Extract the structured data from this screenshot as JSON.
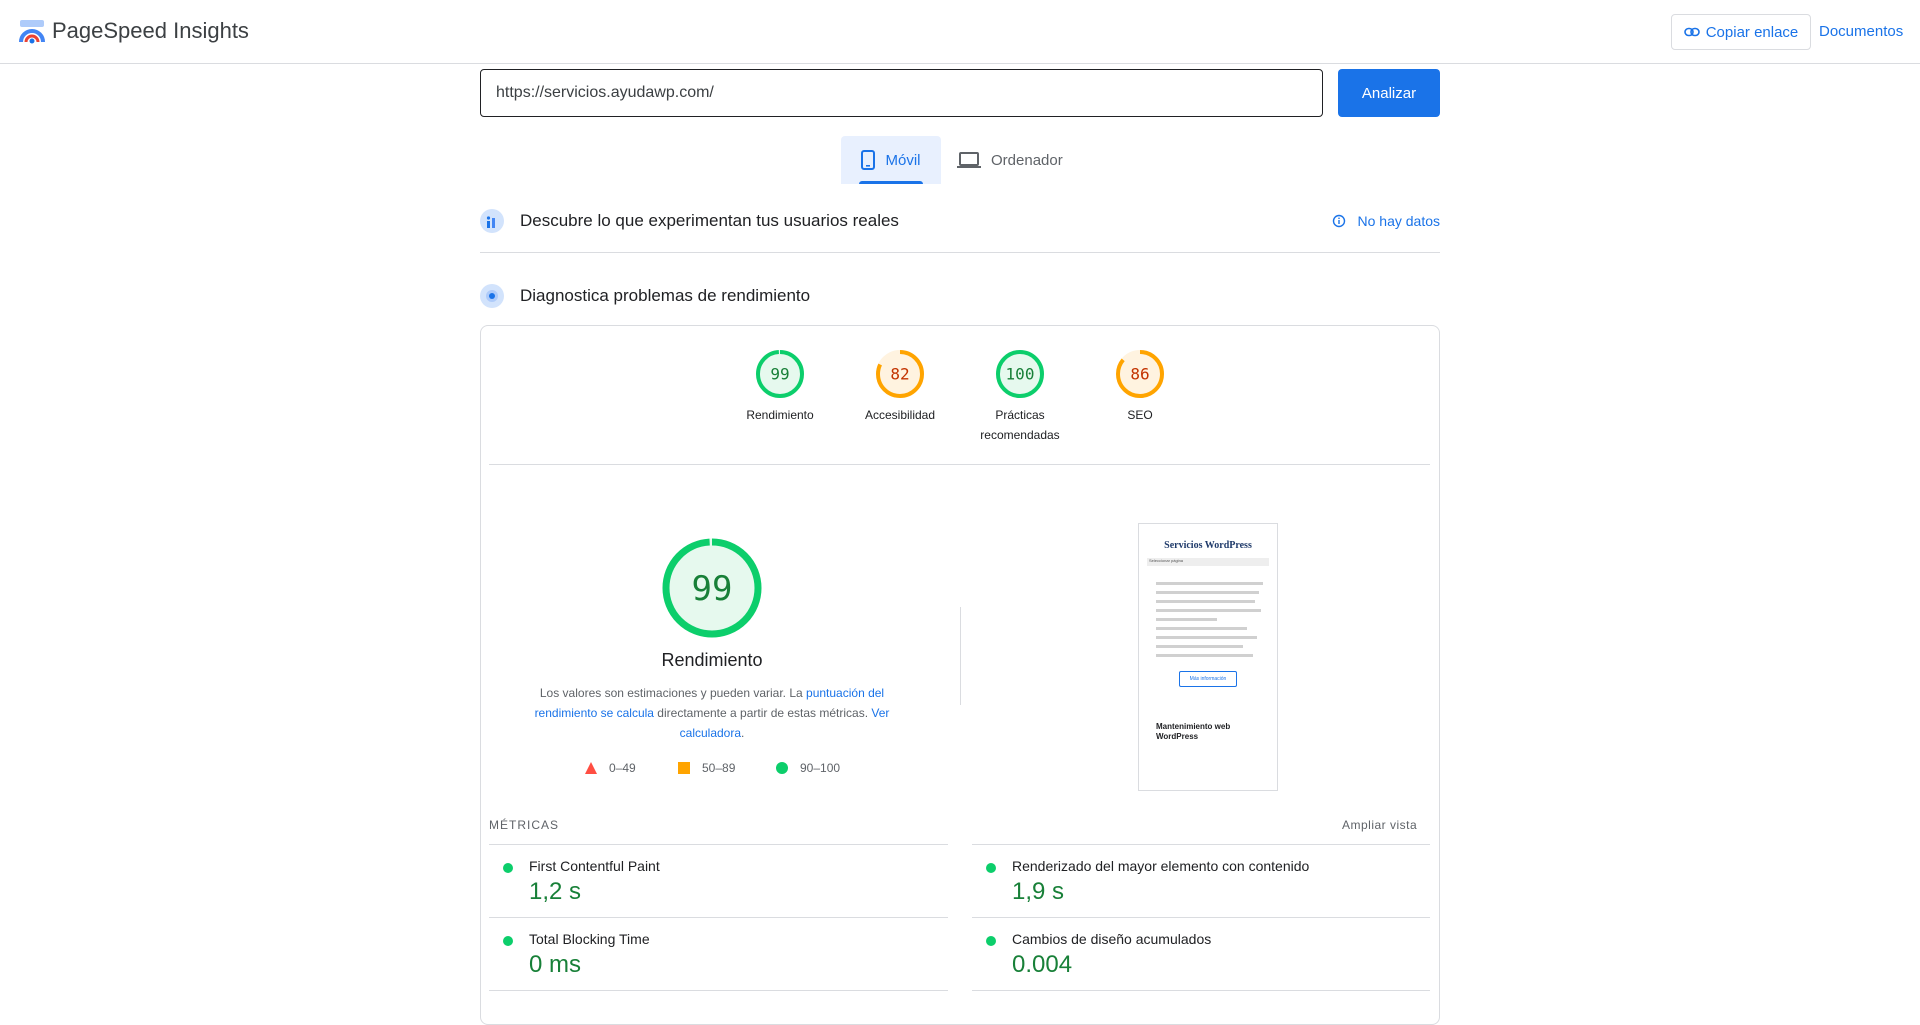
{
  "header": {
    "app_name": "PageSpeed Insights",
    "copy_link_label": "Copiar enlace",
    "docs_label": "Documentos"
  },
  "search": {
    "url_value": "https://servicios.ayudawp.com/",
    "analyze_label": "Analizar"
  },
  "device_tabs": [
    {
      "label": "Móvil",
      "selected": true
    },
    {
      "label": "Ordenador",
      "selected": false
    }
  ],
  "field_data": {
    "title": "Descubre lo que experimentan tus usuarios reales",
    "status": "No hay datos"
  },
  "diagnostics": {
    "title": "Diagnostica problemas de rendimiento"
  },
  "scores": [
    {
      "value": 99,
      "label_lines": [
        "Rendimiento"
      ],
      "color": "#0cce6b",
      "text_color": "#188038",
      "bg": "#e6f9ee"
    },
    {
      "value": 82,
      "label_lines": [
        "Accesibilidad"
      ],
      "color": "#ffa400",
      "text_color": "#c33300",
      "bg": "#fff3e0"
    },
    {
      "value": 100,
      "label_lines": [
        "Prácticas",
        "recomendadas"
      ],
      "color": "#0cce6b",
      "text_color": "#188038",
      "bg": "#e6f9ee"
    },
    {
      "value": 86,
      "label_lines": [
        "SEO"
      ],
      "color": "#ffa400",
      "text_color": "#c33300",
      "bg": "#fff3e0"
    }
  ],
  "performance": {
    "score": 99,
    "title": "Rendimiento",
    "note_part1": "Los valores son estimaciones y pueden variar. La ",
    "note_link1": "puntuación del rendimiento se calcula",
    "note_part2": " directamente a partir de estas métricas. ",
    "note_link2": "Ver calculadora",
    "note_part3": "."
  },
  "legend": [
    {
      "range": "0–49",
      "shape": "triangle",
      "color": "#ff4e42"
    },
    {
      "range": "50–89",
      "shape": "square",
      "color": "#ffa400"
    },
    {
      "range": "90–100",
      "shape": "circle",
      "color": "#0cce6b"
    }
  ],
  "preview": {
    "brand": "Servicios WordPress",
    "nav_label": "Seleccionar página",
    "button_label": "Más información",
    "heading": "Mantenimiento web WordPress"
  },
  "metrics": {
    "heading": "MÉTRICAS",
    "expand_label": "Ampliar vista",
    "items": [
      {
        "name": "First Contentful Paint",
        "value": "1,2 s"
      },
      {
        "name": "Renderizado del mayor elemento con contenido",
        "value": "1,9 s"
      },
      {
        "name": "Total Blocking Time",
        "value": "0 ms"
      },
      {
        "name": "Cambios de diseño acumulados",
        "value": "0.004"
      }
    ]
  }
}
